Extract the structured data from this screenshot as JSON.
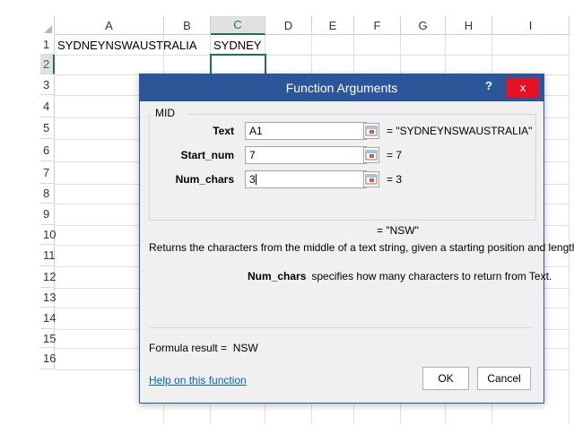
{
  "sheet": {
    "columns": [
      "A",
      "B",
      "C",
      "D",
      "E",
      "F",
      "G",
      "H",
      "I"
    ],
    "rows": [
      "1",
      "2",
      "3",
      "4",
      "5",
      "6",
      "7",
      "8",
      "9",
      "10",
      "11",
      "12",
      "13",
      "14",
      "15",
      "16"
    ],
    "selected_column": "C",
    "selected_row": "2",
    "cells": {
      "A1": "SYDNEYNSWAUSTRALIA",
      "C1": "SYDNEY"
    },
    "accent_color": "#217346"
  },
  "dialog": {
    "title": "Function Arguments",
    "help_label": "?",
    "close_label": "x",
    "function_name": "MID",
    "args": [
      {
        "label": "Text",
        "value": "A1",
        "result": "=  \"SYDNEYNSWAUSTRALIA\""
      },
      {
        "label": "Start_num",
        "value": "7",
        "result": "=  7"
      },
      {
        "label": "Num_chars",
        "value": "3",
        "result": "=  3"
      }
    ],
    "overall_result": "=  \"NSW\"",
    "description": "Returns the characters from the middle of a text string, given a starting position and length.",
    "param_name": "Num_chars",
    "param_description": "specifies how many characters to return from Text.",
    "formula_result_label": "Formula result =",
    "formula_result_value": "NSW",
    "help_link": "Help on this function",
    "ok_label": "OK",
    "cancel_label": "Cancel",
    "title_bar_color": "#2b579a",
    "close_color": "#e81123"
  }
}
